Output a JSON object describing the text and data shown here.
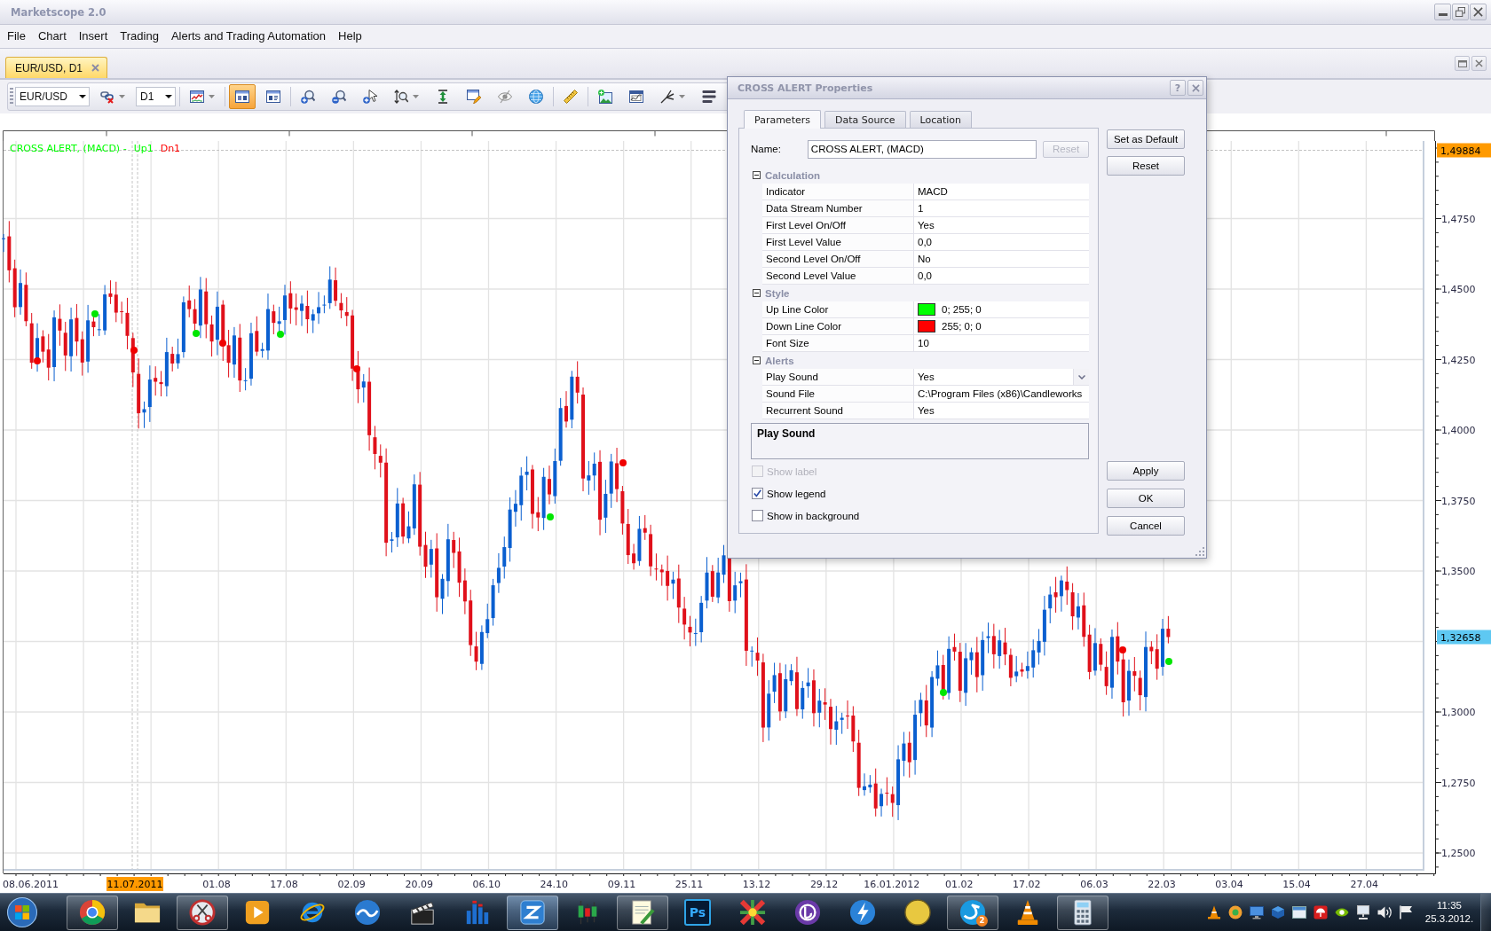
{
  "window": {
    "title": "Marketscope 2.0"
  },
  "menu": [
    "File",
    "Chart",
    "Insert",
    "Trading",
    "Alerts and Trading Automation",
    "Help"
  ],
  "document_tabs": [
    {
      "label": "EUR/USD, D1",
      "selected": true
    }
  ],
  "toolbar": {
    "groups": [
      [
        {
          "kind": "combo",
          "value": "EUR/USD"
        },
        {
          "kind": "button",
          "selected": false,
          "menu": true
        },
        {
          "kind": "combo",
          "value": "D1"
        }
      ],
      [
        {
          "kind": "button",
          "selected": false,
          "menu": true
        }
      ],
      [
        {
          "kind": "button",
          "selected": true,
          "menu": false
        },
        {
          "kind": "button",
          "selected": false,
          "menu": false
        }
      ],
      [
        {
          "kind": "button",
          "selected": false,
          "menu": false
        },
        {
          "kind": "button",
          "selected": false,
          "menu": false
        },
        {
          "kind": "button",
          "selected": false,
          "menu": false
        },
        {
          "kind": "button",
          "selected": false,
          "menu": true
        },
        {
          "kind": "button",
          "selected": false,
          "menu": false
        },
        {
          "kind": "button",
          "selected": false,
          "menu": false
        },
        {
          "kind": "button",
          "selected": false,
          "menu": false
        },
        {
          "kind": "button",
          "selected": false,
          "menu": false
        }
      ],
      [
        {
          "kind": "button",
          "selected": false,
          "menu": false
        }
      ],
      [
        {
          "kind": "button",
          "selected": false,
          "menu": false
        },
        {
          "kind": "button",
          "selected": false,
          "menu": false
        },
        {
          "kind": "button",
          "selected": false,
          "menu": true
        },
        {
          "kind": "button",
          "selected": false,
          "menu": false
        }
      ]
    ]
  },
  "chart": {
    "legend": [
      {
        "text": "CROSS ALERT, (MACD) -",
        "color": "#00ff00"
      },
      {
        "text": "Up1",
        "color": "#00ff00"
      },
      {
        "text": "Dn1",
        "color": "#ff0000"
      }
    ],
    "price_axis": [
      {
        "text": "1,49884",
        "kind": "cursor"
      },
      {
        "text": "1,4750",
        "kind": "tick"
      },
      {
        "text": "1,4500",
        "kind": "tick"
      },
      {
        "text": "1,4250",
        "kind": "tick"
      },
      {
        "text": "1,4000",
        "kind": "tick"
      },
      {
        "text": "1,3750",
        "kind": "tick"
      },
      {
        "text": "1,3500",
        "kind": "tick"
      },
      {
        "text": "1,32658",
        "kind": "last"
      },
      {
        "text": "1,3000",
        "kind": "tick"
      },
      {
        "text": "1,2750",
        "kind": "tick"
      },
      {
        "text": "1,2500",
        "kind": "tick"
      }
    ],
    "date_axis": [
      {
        "text": "08.06.2011",
        "kind": "start"
      },
      {
        "text": "11.07.2011",
        "kind": "cursor"
      },
      {
        "text": "01.08",
        "kind": "tick"
      },
      {
        "text": "17.08",
        "kind": "tick"
      },
      {
        "text": "02.09",
        "kind": "tick"
      },
      {
        "text": "20.09",
        "kind": "tick"
      },
      {
        "text": "06.10",
        "kind": "tick"
      },
      {
        "text": "24.10",
        "kind": "tick"
      },
      {
        "text": "09.11",
        "kind": "tick"
      },
      {
        "text": "25.11",
        "kind": "tick"
      },
      {
        "text": "13.12",
        "kind": "tick"
      },
      {
        "text": "29.12",
        "kind": "tick"
      },
      {
        "text": "16.01.2012",
        "kind": "tick"
      },
      {
        "text": "01.02",
        "kind": "tick"
      },
      {
        "text": "17.02",
        "kind": "tick"
      },
      {
        "text": "06.03",
        "kind": "tick"
      },
      {
        "text": "22.03",
        "kind": "tick"
      },
      {
        "text": "03.04",
        "kind": "tick"
      },
      {
        "text": "15.04",
        "kind": "tick"
      },
      {
        "text": "27.04",
        "kind": "tick"
      }
    ]
  },
  "dialog": {
    "title": "CROSS ALERT Properties",
    "help_button": "?",
    "tabs": [
      {
        "label": "Parameters",
        "selected": true
      },
      {
        "label": "Data Source",
        "selected": false
      },
      {
        "label": "Location",
        "selected": false
      }
    ],
    "name_label": "Name:",
    "name_value": "CROSS ALERT, (MACD)",
    "name_reset": {
      "label": "Reset",
      "disabled": true
    },
    "groups": [
      {
        "title": "Calculation",
        "expanded": true,
        "rows": [
          {
            "label": "Indicator",
            "value": "MACD",
            "kind": "text"
          },
          {
            "label": "Data Stream Number",
            "value": "1",
            "kind": "text"
          },
          {
            "label": "First Level On/Off",
            "value": "Yes",
            "kind": "text"
          },
          {
            "label": "First Level Value",
            "value": "0,0",
            "kind": "text"
          },
          {
            "label": "Second Level On/Off",
            "value": "No",
            "kind": "text"
          },
          {
            "label": "Second Level Value",
            "value": "0,0",
            "kind": "text"
          }
        ]
      },
      {
        "title": "Style",
        "expanded": true,
        "rows": [
          {
            "label": "Up Line Color",
            "value": "0; 255; 0",
            "kind": "color",
            "color": "#00ff00"
          },
          {
            "label": "Down Line Color",
            "value": "255; 0; 0",
            "kind": "color",
            "color": "#ff0000"
          },
          {
            "label": "Font Size",
            "value": "10",
            "kind": "text"
          }
        ]
      },
      {
        "title": "Alerts",
        "expanded": true,
        "rows": [
          {
            "label": "Play Sound",
            "value": "Yes",
            "kind": "dropdown"
          },
          {
            "label": "Sound File",
            "value": "C:\\Program Files (x86)\\Candleworks",
            "kind": "text"
          },
          {
            "label": "Recurrent Sound",
            "value": "Yes",
            "kind": "text"
          }
        ]
      }
    ],
    "description": {
      "title": "Play Sound"
    },
    "options": [
      {
        "label": "Show label",
        "checked": false,
        "disabled": true
      },
      {
        "label": "Show legend",
        "checked": true,
        "disabled": false
      },
      {
        "label": "Show in background",
        "checked": false,
        "disabled": false
      }
    ],
    "side_buttons": [
      {
        "label": "Set as Default"
      },
      {
        "label": "Reset"
      }
    ],
    "bottom_buttons": [
      {
        "label": "Apply"
      },
      {
        "label": "OK"
      },
      {
        "label": "Cancel"
      }
    ]
  },
  "taskbar": {
    "apps": [
      {
        "running": true,
        "selected": false
      },
      {
        "running": false,
        "selected": false
      },
      {
        "running": true,
        "selected": false
      },
      {
        "running": false,
        "selected": false
      },
      {
        "running": false,
        "selected": false
      },
      {
        "running": false,
        "selected": false
      },
      {
        "running": false,
        "selected": false
      },
      {
        "running": false,
        "selected": false
      },
      {
        "running": true,
        "selected": true
      },
      {
        "running": false,
        "selected": false
      },
      {
        "running": true,
        "selected": false
      },
      {
        "running": false,
        "selected": false,
        "label": "Ps"
      },
      {
        "running": false,
        "selected": false
      },
      {
        "running": false,
        "selected": false
      },
      {
        "running": false,
        "selected": false
      },
      {
        "running": false,
        "selected": false
      },
      {
        "running": true,
        "selected": false,
        "badge": "2"
      },
      {
        "running": false,
        "selected": false
      },
      {
        "running": true,
        "selected": false
      }
    ],
    "time": "11:35",
    "date": "25.3.2012."
  }
}
